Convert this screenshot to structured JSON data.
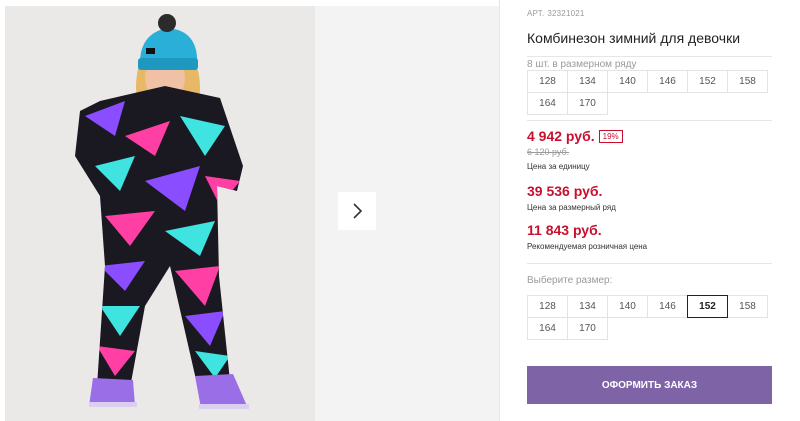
{
  "product": {
    "article_label": "АРТ.",
    "article_number": "32321021",
    "title": "Комбинезон зимний для девочки",
    "pack_caption": "8 шт. в размерном ряду",
    "pack_sizes": [
      "128",
      "134",
      "140",
      "146",
      "152",
      "158",
      "164",
      "170"
    ],
    "price": "4 942 руб.",
    "discount": "19%",
    "old_price": "6 120 руб.",
    "price_caption": "Цена за единицу",
    "row_price": "39 536 руб.",
    "row_price_caption": "Цена за размерный ряд",
    "retail_price": "11 843 руб.",
    "retail_caption": "Рекомендуемая розничная цена",
    "select_caption": "Выберите размер:",
    "select_sizes": [
      "128",
      "134",
      "140",
      "146",
      "152",
      "158",
      "164",
      "170"
    ],
    "selected_size": "152",
    "order_button": "ОФОРМИТЬ ЗАКАЗ"
  },
  "gallery": {
    "next_icon": "chevron-right-icon",
    "accent_colors": {
      "pink": "#ff3fa4",
      "purple": "#8a4dff",
      "cyan": "#3fe3e0",
      "suit": "#1a1820",
      "hat": "#2ab0d8"
    }
  },
  "colors": {
    "price": "#c8102e",
    "button": "#7e64a6"
  }
}
